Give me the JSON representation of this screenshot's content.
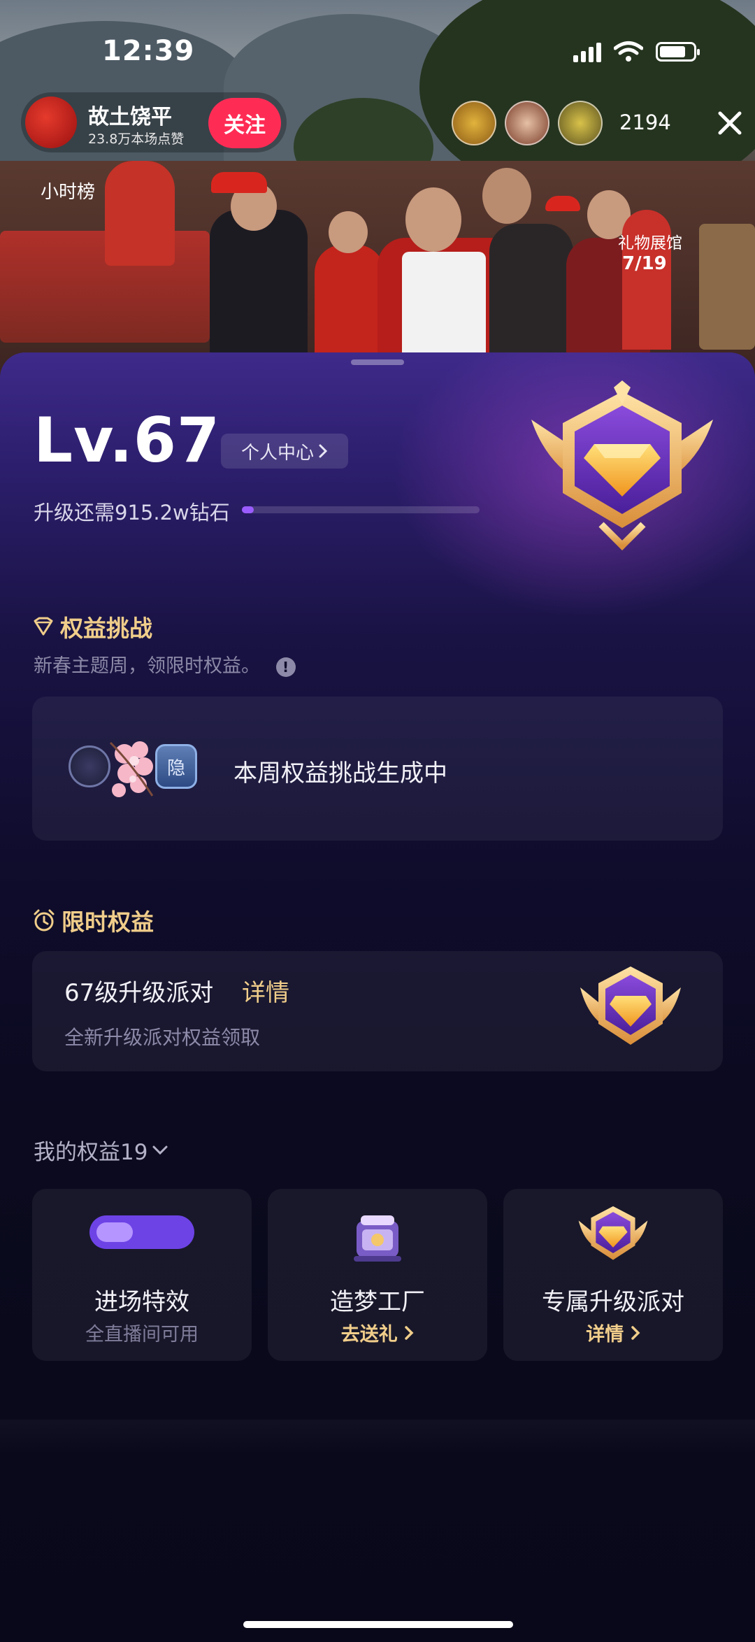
{
  "status_bar": {
    "time": "12:39"
  },
  "live_header": {
    "host_name": "故土饶平",
    "host_likes": "23.8万本场点赞",
    "follow_label": "关注",
    "hour_rank_label": "小时榜",
    "viewer_count": "2194",
    "close_icon": "close-icon",
    "gift_hall_label": "礼物展馆",
    "gift_hall_count": "7/19"
  },
  "level": {
    "title": "Lv.67",
    "personal_center": "个人中心",
    "upgrade_tip": "升级还需915.2w钻石",
    "progress": 0.05
  },
  "benefit_challenge": {
    "title": "权益挑战",
    "subtitle": "新春主题周，领限时权益。",
    "status_text": "本周权益挑战生成中",
    "badge_text": "隐"
  },
  "limited_benefit": {
    "title": "限时权益",
    "item_title": "67级升级派对",
    "item_detail": "详情",
    "item_sub": "全新升级派对权益领取"
  },
  "my_benefits": {
    "title": "我的权益19",
    "items": [
      {
        "label": "进场特效",
        "sub": "全直播间可用"
      },
      {
        "label": "造梦工厂",
        "link": "去送礼"
      },
      {
        "label": "专属升级派对",
        "link": "详情"
      }
    ]
  },
  "colors": {
    "accent_gold": "#f0cd8a",
    "follow_red": "#fe2c55",
    "progress_purple": "#9b5cff"
  }
}
